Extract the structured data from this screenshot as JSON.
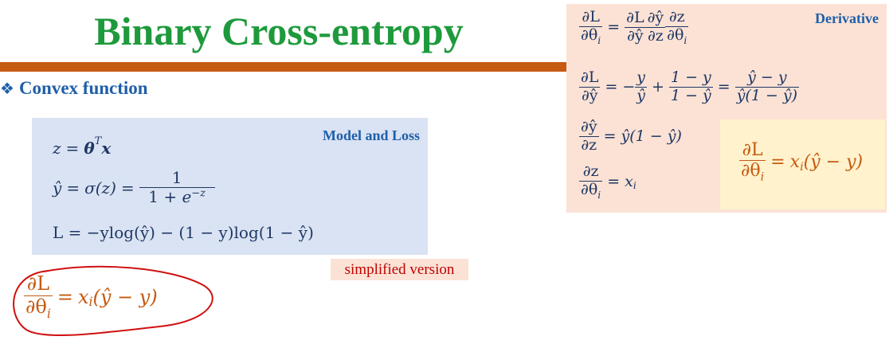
{
  "title": "Binary Cross-entropy",
  "section": {
    "bullet": "❖",
    "label": "Convex function"
  },
  "model_box": {
    "label": "Model and Loss",
    "z_lhs": "z",
    "eq": "=",
    "theta": "θ",
    "T": "T",
    "x": "x",
    "yhat_lhs": "ŷ",
    "sigma": "σ(z)",
    "one": "1",
    "den_1": "1 + ",
    "e": "e",
    "exp": "−z",
    "loss": "L = −ylog(ŷ) − (1 − y)log(1 − ŷ)"
  },
  "note": "simplified version",
  "simplified": {
    "num": "∂L",
    "den_base": "∂θ",
    "den_sub": "i",
    "eq": "=",
    "rhs_x": "x",
    "rhs_sub": "i",
    "rhs_rest": "(ŷ − y)"
  },
  "derivative_box": {
    "label": "Derivative",
    "chain": {
      "dL": "∂L",
      "dtheta": "∂θ",
      "i": "i",
      "dyhat": "∂ŷ",
      "dz": "∂z",
      "eq": "="
    },
    "second": {
      "dL": "∂L",
      "dyhat": "∂ŷ",
      "eq": "=",
      "minus": "−",
      "y": "y",
      "yhat": "ŷ",
      "plus": "+",
      "one_minus_y": "1 − y",
      "one_minus_yhat": "1 − ŷ",
      "yhat_minus_y": "ŷ − y",
      "yhat_times": "ŷ(1 − ŷ)"
    },
    "third": {
      "dyhat": "∂ŷ",
      "dz": "∂z",
      "eq": "=",
      "rhs": "ŷ(1 − ŷ)"
    },
    "fourth": {
      "dz": "∂z",
      "dtheta": "∂θ",
      "i": "i",
      "eq": "=",
      "x": "x",
      "xi": "i"
    }
  },
  "result": {
    "num": "∂L",
    "den_base": "∂θ",
    "den_sub": "i",
    "eq": "=",
    "rhs_x": "x",
    "rhs_sub": "i",
    "rhs_rest": "(ŷ − y)"
  },
  "colors": {
    "title": "#1e9a3c",
    "rule": "#c55a11",
    "section": "#1f5fa8",
    "model_bg": "#dae3f3",
    "deriv_bg": "#fbe2d5",
    "result_bg": "#fff2cc",
    "math": "#1f3864",
    "orange": "#c55a11",
    "ink_circle": "#d01010"
  }
}
